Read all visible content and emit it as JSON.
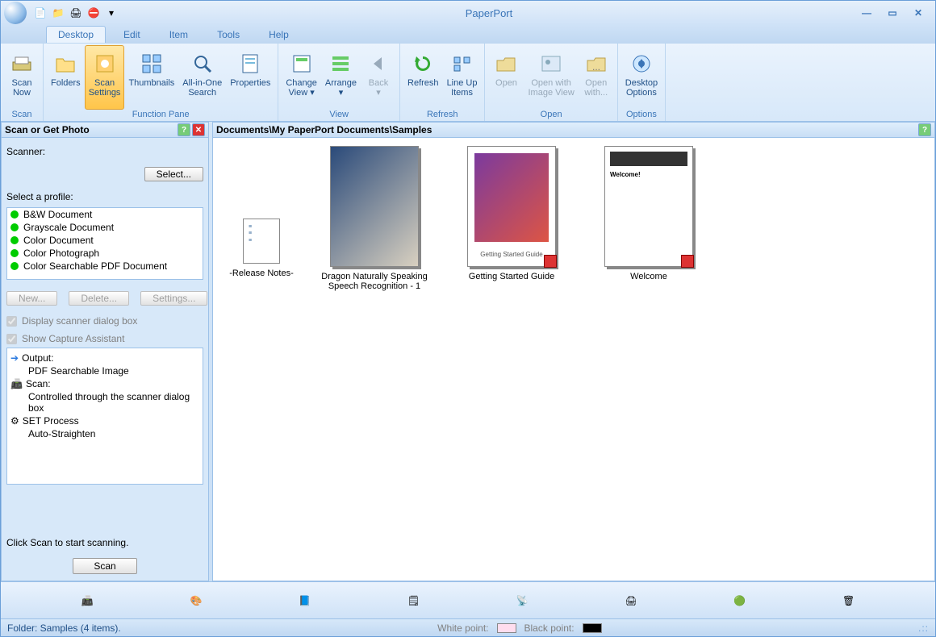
{
  "app_title": "PaperPort",
  "tabs": [
    "Desktop",
    "Edit",
    "Item",
    "Tools",
    "Help"
  ],
  "active_tab": 0,
  "ribbon": {
    "groups": [
      {
        "label": "Scan",
        "buttons": [
          {
            "label": "Scan\nNow",
            "icon": "scanner",
            "disabled": false
          }
        ]
      },
      {
        "label": "Function Pane",
        "buttons": [
          {
            "label": "Folders",
            "icon": "folder",
            "disabled": false
          },
          {
            "label": "Scan\nSettings",
            "icon": "scan-settings",
            "disabled": false,
            "highlight": true
          },
          {
            "label": "Thumbnails",
            "icon": "thumbnails",
            "disabled": false
          },
          {
            "label": "All-in-One\nSearch",
            "icon": "search",
            "disabled": false
          },
          {
            "label": "Properties",
            "icon": "properties",
            "disabled": false
          }
        ]
      },
      {
        "label": "View",
        "buttons": [
          {
            "label": "Change\nView ▾",
            "icon": "change-view",
            "disabled": false
          },
          {
            "label": "Arrange\n▾",
            "icon": "arrange",
            "disabled": false
          },
          {
            "label": "Back\n▾",
            "icon": "back",
            "disabled": true
          }
        ]
      },
      {
        "label": "Refresh",
        "buttons": [
          {
            "label": "Refresh",
            "icon": "refresh",
            "disabled": false
          },
          {
            "label": "Line Up\nItems",
            "icon": "lineup",
            "disabled": false
          }
        ]
      },
      {
        "label": "Open",
        "buttons": [
          {
            "label": "Open",
            "icon": "open",
            "disabled": true
          },
          {
            "label": "Open with\nImage View",
            "icon": "open-image",
            "disabled": true
          },
          {
            "label": "Open\nwith...",
            "icon": "open-with",
            "disabled": true
          }
        ]
      },
      {
        "label": "Options",
        "buttons": [
          {
            "label": "Desktop\nOptions",
            "icon": "options",
            "disabled": false
          }
        ]
      }
    ]
  },
  "left_panel": {
    "title": "Scan or Get Photo",
    "scanner_label": "Scanner:",
    "select_btn": "Select...",
    "profile_label": "Select a profile:",
    "profiles": [
      "B&W Document",
      "Grayscale Document",
      "Color Document",
      "Color Photograph",
      "Color Searchable PDF Document"
    ],
    "new_btn": "New...",
    "delete_btn": "Delete...",
    "settings_btn": "Settings...",
    "chk_dialog": "Display scanner dialog box",
    "chk_assistant": "Show Capture Assistant",
    "output": {
      "output_label": "Output:",
      "output_value": "PDF Searchable Image",
      "scan_label": "Scan:",
      "scan_value": "Controlled through the scanner dialog box",
      "set_label": "SET Process",
      "set_value": "Auto-Straighten"
    },
    "hint": "Click Scan to start scanning.",
    "scan_btn": "Scan"
  },
  "breadcrumb": "Documents\\My PaperPort Documents\\Samples",
  "thumbnails": [
    {
      "caption": "-Release Notes-",
      "kind": "txt"
    },
    {
      "caption": "Dragon Naturally Speaking Speech Recognition - 1",
      "kind": "photo"
    },
    {
      "caption": "Getting Started Guide",
      "kind": "pdf"
    },
    {
      "caption": "Welcome",
      "kind": "pdf"
    }
  ],
  "statusbar": {
    "folder": "Folder: Samples (4 items).",
    "white_label": "White point:",
    "black_label": "Black point:"
  }
}
